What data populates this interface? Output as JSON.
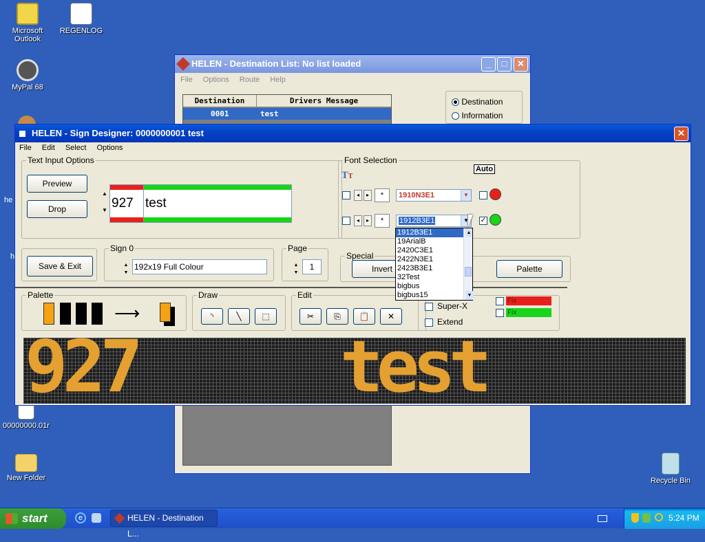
{
  "desktop": {
    "icons": [
      {
        "label1": "Microsoft",
        "label2": "Outlook"
      },
      {
        "label1": "REGENLOG",
        "label2": ""
      },
      {
        "label1": "MyPal 68",
        "label2": ""
      },
      {
        "label1": "00000000.01r",
        "label2": ""
      },
      {
        "label1": "New Folder",
        "label2": ""
      },
      {
        "label1": "Recycle Bin",
        "label2": ""
      }
    ],
    "edge_text1": "he",
    "edge_text2": "h"
  },
  "dest_window": {
    "title": "HELEN - Destination List: No list loaded",
    "menu": [
      "File",
      "Options",
      "Route",
      "Help"
    ],
    "col_destination": "Destination",
    "col_message": "Drivers Message",
    "row_dest": "0001",
    "row_message": "test",
    "radio_destination": "Destination",
    "radio_information": "Information"
  },
  "designer": {
    "title": "HELEN - Sign Designer: 0000000001 test",
    "menu": [
      "File",
      "Edit",
      "Select",
      "Options"
    ],
    "text_input_label": "Text Input Options",
    "preview": "Preview",
    "drop": "Drop",
    "route_number": "927",
    "dest_text": "test",
    "font_selection_label": "Font Selection",
    "auto": "Auto",
    "font1": "1910N3E1",
    "font2": "1912B3E1",
    "star": "*",
    "font_options": [
      "1912B3E1",
      "19ArialB",
      "2420C3E1",
      "2422N3E1",
      "2423B3E1",
      "32Test",
      "bigbus",
      "bigbus15"
    ],
    "save_exit": "Save & Exit",
    "sign_label": "Sign 0",
    "sign_value": "192x19 Full Colour",
    "page_label": "Page",
    "page_value": "1",
    "special_label": "Special",
    "invert": "Invert",
    "palette_btn": "Palette",
    "palette_label": "Palette",
    "draw_label": "Draw",
    "edit_label": "Edit",
    "super_x": "Super-X",
    "extend": "Extend",
    "fix1": "Fix",
    "fix2": "Fix",
    "led_route": "927",
    "led_dest": "test",
    "colors": {
      "led_amber": "#e4a030",
      "led_bg": "#1c1c1c",
      "red": "#e8201c",
      "green": "#19d419"
    }
  },
  "taskbar": {
    "start": "start",
    "task": "HELEN - Destination L...",
    "clock": "5:24 PM"
  }
}
